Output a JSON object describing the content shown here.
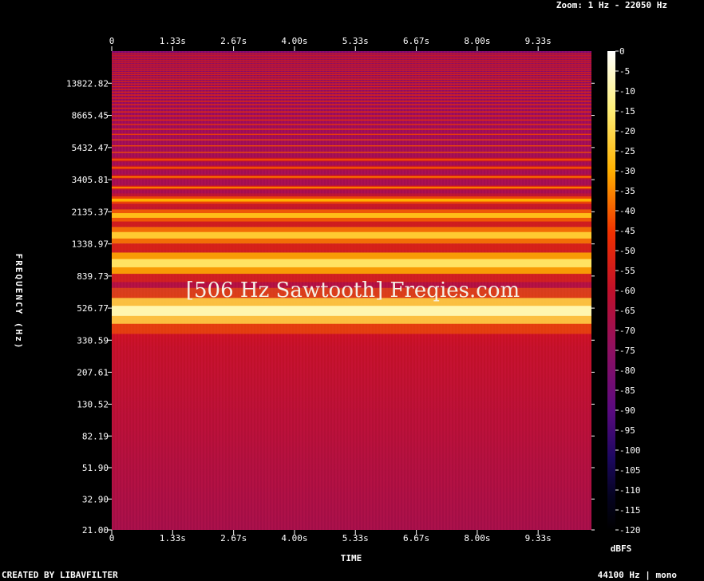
{
  "header": {
    "zoom_label": "Zoom: 1 Hz - 22050 Hz"
  },
  "footer": {
    "left": "CREATED BY LIBAVFILTER",
    "right": "44100 Hz | mono"
  },
  "watermark": "[506 Hz Sawtooth] Freqies.com",
  "colors": {
    "background": "#000000",
    "scale": [
      "#000000",
      "#0a0a4a",
      "#5a0a8a",
      "#a0105a",
      "#e01010",
      "#ff6000",
      "#ffd000",
      "#ffffff"
    ]
  },
  "chart_data": {
    "type": "heatmap",
    "title": "",
    "xlabel": "TIME",
    "ylabel": "FREQUENCY (Hz)",
    "x_ticks": [
      "0",
      "1.33s",
      "2.67s",
      "4.00s",
      "5.33s",
      "6.67s",
      "8.00s",
      "9.33s"
    ],
    "x_tick_values": [
      0,
      1.333,
      2.667,
      4.0,
      5.333,
      6.667,
      8.0,
      9.333
    ],
    "xlim": [
      0,
      10.5
    ],
    "y_ticks": [
      "13822.82",
      "8665.45",
      "5432.47",
      "3405.81",
      "2135.37",
      "1338.97",
      "839.73",
      "526.77",
      "330.59",
      "207.61",
      "130.52",
      "82.19",
      "51.90",
      "32.90",
      "21.00"
    ],
    "y_tick_values": [
      13822.82,
      8665.45,
      5432.47,
      3405.81,
      2135.37,
      1338.97,
      839.73,
      526.77,
      330.59,
      207.61,
      130.52,
      82.19,
      51.9,
      32.9,
      21.0
    ],
    "ylim": [
      21,
      22050
    ],
    "y_scale": "log",
    "colorbar_label": "dBFS",
    "colorbar_ticks": [
      "0",
      "-5",
      "-10",
      "-15",
      "-20",
      "-25",
      "-30",
      "-35",
      "-40",
      "-45",
      "-50",
      "-55",
      "-60",
      "-65",
      "-70",
      "-75",
      "-80",
      "-85",
      "-90",
      "-95",
      "-100",
      "-105",
      "-110",
      "-115",
      "-120"
    ],
    "colorbar_range": [
      -120,
      0
    ],
    "fundamental_hz": 506,
    "harmonics": [
      {
        "freq": 506,
        "db": -6
      },
      {
        "freq": 1012,
        "db": -12
      },
      {
        "freq": 1518,
        "db": -16
      },
      {
        "freq": 2024,
        "db": -18
      },
      {
        "freq": 2530,
        "db": -20
      },
      {
        "freq": 3036,
        "db": -22
      },
      {
        "freq": 3542,
        "db": -24
      },
      {
        "freq": 4048,
        "db": -26
      },
      {
        "freq": 4554,
        "db": -27
      }
    ],
    "background_db": -62
  }
}
